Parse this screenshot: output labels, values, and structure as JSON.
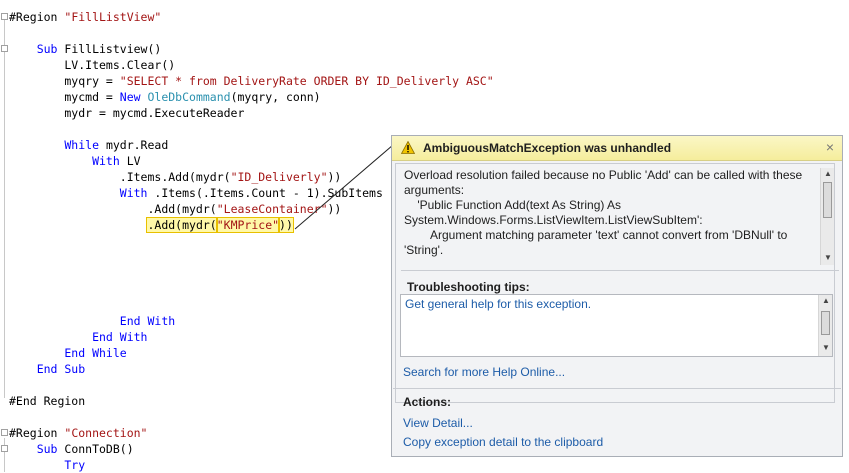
{
  "editor": {
    "lines": [
      {
        "parts": [
          {
            "t": "#Region ",
            "c": ""
          },
          {
            "t": "\"FillListView\"",
            "c": "str"
          }
        ]
      },
      {
        "parts": []
      },
      {
        "parts": [
          {
            "t": "    Sub ",
            "c": "kw"
          },
          {
            "t": "FillListview()",
            "c": ""
          }
        ]
      },
      {
        "parts": [
          {
            "t": "        LV.Items.Clear()",
            "c": ""
          }
        ]
      },
      {
        "parts": [
          {
            "t": "        myqry = ",
            "c": ""
          },
          {
            "t": "\"SELECT * from DeliveryRate ORDER BY ID_Deliverly ASC\"",
            "c": "str"
          }
        ]
      },
      {
        "parts": [
          {
            "t": "        mycmd = ",
            "c": ""
          },
          {
            "t": "New ",
            "c": "kw"
          },
          {
            "t": "OleDbCommand",
            "c": "typ"
          },
          {
            "t": "(myqry, conn)",
            "c": ""
          }
        ]
      },
      {
        "parts": [
          {
            "t": "        mydr = mycmd.ExecuteReader",
            "c": ""
          }
        ]
      },
      {
        "parts": []
      },
      {
        "parts": [
          {
            "t": "        While ",
            "c": "kw"
          },
          {
            "t": "mydr.Read",
            "c": ""
          }
        ]
      },
      {
        "parts": [
          {
            "t": "            With ",
            "c": "kw"
          },
          {
            "t": "LV",
            "c": ""
          }
        ]
      },
      {
        "parts": [
          {
            "t": "                .Items.Add(mydr(",
            "c": ""
          },
          {
            "t": "\"ID_Deliverly\"",
            "c": "str"
          },
          {
            "t": "))",
            "c": ""
          }
        ]
      },
      {
        "parts": [
          {
            "t": "                With ",
            "c": "kw"
          },
          {
            "t": ".Items(.Items.Count - 1).SubItems",
            "c": ""
          }
        ]
      },
      {
        "parts": [
          {
            "t": "                    .Add(mydr(",
            "c": ""
          },
          {
            "t": "\"LeaseContainer\"",
            "c": "str"
          },
          {
            "t": "))",
            "c": ""
          }
        ]
      },
      {
        "parts": [
          {
            "t": "                    ",
            "c": ""
          },
          {
            "t": ".Add(mydr(",
            "c": "hl"
          },
          {
            "t": "\"KMPrice\"",
            "c": "hl str"
          },
          {
            "t": "))",
            "c": "hl"
          }
        ]
      },
      {
        "parts": []
      },
      {
        "parts": []
      },
      {
        "parts": []
      },
      {
        "parts": []
      },
      {
        "parts": []
      },
      {
        "parts": [
          {
            "t": "                End With",
            "c": "kw"
          }
        ]
      },
      {
        "parts": [
          {
            "t": "            End With",
            "c": "kw"
          }
        ]
      },
      {
        "parts": [
          {
            "t": "        End While",
            "c": "kw"
          }
        ]
      },
      {
        "parts": [
          {
            "t": "    End Sub",
            "c": "kw"
          }
        ]
      },
      {
        "parts": []
      },
      {
        "parts": [
          {
            "t": "#End Region",
            "c": ""
          }
        ]
      },
      {
        "parts": []
      },
      {
        "parts": [
          {
            "t": "#Region ",
            "c": ""
          },
          {
            "t": "\"Connection\"",
            "c": "str"
          }
        ]
      },
      {
        "parts": [
          {
            "t": "    Sub ",
            "c": "kw"
          },
          {
            "t": "ConnToDB()",
            "c": ""
          }
        ]
      },
      {
        "parts": [
          {
            "t": "        Try",
            "c": "kw"
          }
        ]
      }
    ]
  },
  "exception": {
    "title": "AmbiguousMatchException was unhandled",
    "close_label": "×",
    "message_lines": [
      "Overload resolution failed because no Public 'Add' can be called with these",
      "arguments:",
      "    'Public Function Add(text As String) As",
      "System.Windows.Forms.ListViewItem.ListViewSubItem':",
      "        Argument matching parameter 'text' cannot convert from 'DBNull' to",
      "'String'."
    ],
    "tips_label": "Troubleshooting tips:",
    "tips_link": "Get general help for this exception.",
    "search_link": "Search for more Help Online...",
    "actions_label": "Actions:",
    "actions": [
      "View Detail...",
      "Copy exception detail to the clipboard"
    ],
    "warning_color": "#f0c400"
  }
}
